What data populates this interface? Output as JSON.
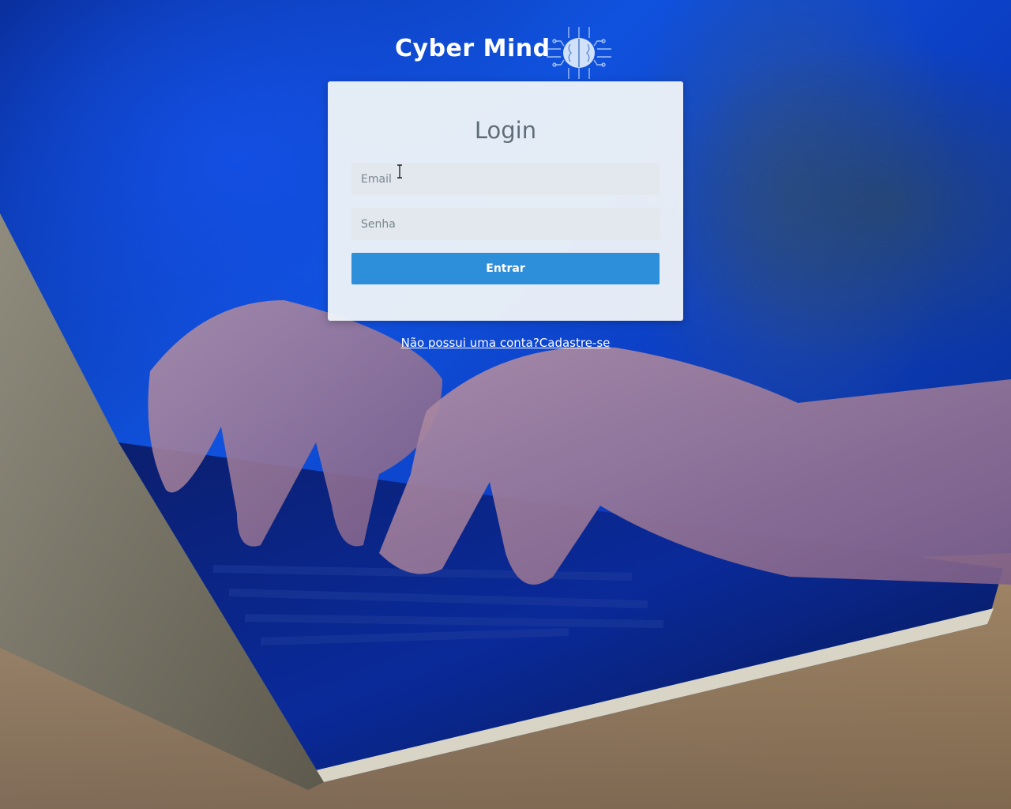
{
  "brand": {
    "name": "Cyber Mind",
    "logo_icon": "brain-circuit-icon"
  },
  "login": {
    "title": "Login",
    "email_placeholder": "Email",
    "password_placeholder": "Senha",
    "submit_label": "Entrar"
  },
  "signup_link": {
    "text": "Não possui uma conta?Cadastre-se"
  },
  "colors": {
    "background": "#0b3cc0",
    "card": "#f0f4f8",
    "field": "#e2e8ee",
    "button": "#2d8fd9",
    "title": "#5f6d78"
  },
  "background_image": "person-typing-on-laptop-photo"
}
